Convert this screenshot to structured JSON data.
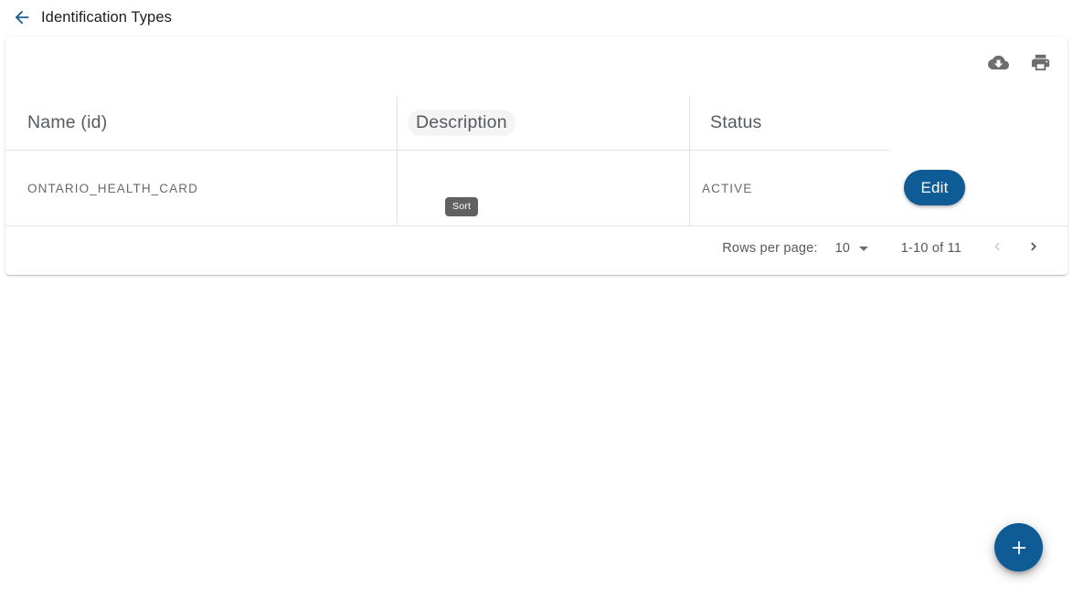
{
  "header": {
    "title": "Identification Types",
    "back_icon": "arrow-left-icon"
  },
  "card": {
    "toolbar": [
      {
        "icon": "cloud-download-icon",
        "name": "download-button"
      },
      {
        "icon": "print-icon",
        "name": "print-button"
      }
    ],
    "table": {
      "columns": [
        {
          "label": "Name (id)",
          "key": "name"
        },
        {
          "label": "Description",
          "key": "description"
        },
        {
          "label": "Status",
          "key": "status"
        }
      ],
      "hovered_column": "Description",
      "rows": [
        {
          "name": "ONTARIO_HEALTH_CARD",
          "description": "",
          "status": "ACTIVE",
          "action_label": "Edit"
        }
      ]
    },
    "tooltip": {
      "text": "Sort"
    },
    "paginator": {
      "rows_per_page_label": "Rows per page:",
      "rows_per_page_value": "10",
      "range_label": "1-10 of 11",
      "prev_icon": "chevron-left-icon",
      "next_icon": "chevron-right-icon",
      "prev_disabled": true,
      "next_disabled": false
    }
  },
  "fab": {
    "icon": "plus-icon",
    "label": "+"
  },
  "colors": {
    "accent_blue": "#0f5b95",
    "back_arrow_blue": "#1b5e8c",
    "tooltip_gray": "#616161",
    "header_text": "#555a5f",
    "cell_text": "#646a70",
    "divider": "#e0e0e0"
  }
}
